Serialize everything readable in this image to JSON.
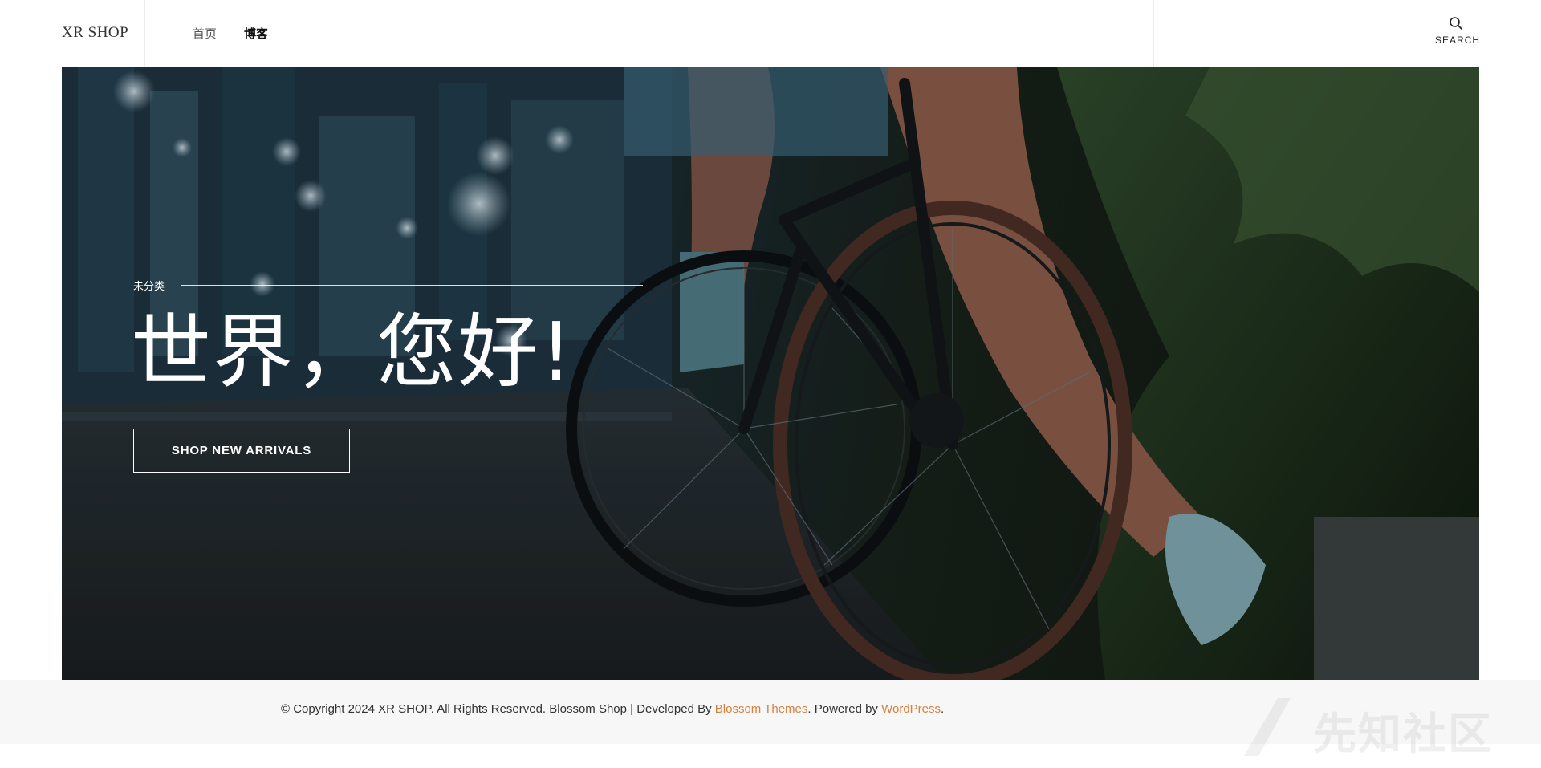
{
  "header": {
    "logo": "XR SHOP",
    "nav": [
      {
        "label": "首页",
        "active": false
      },
      {
        "label": "博客",
        "active": true
      }
    ],
    "search_label": "SEARCH"
  },
  "hero": {
    "category": "未分类",
    "title": "世界，您好!",
    "cta_label": "SHOP NEW ARRIVALS"
  },
  "footer": {
    "copyright": "© Copyright 2024 XR SHOP. All Rights Reserved. Blossom Shop | Developed By ",
    "developer_link": "Blossom Themes",
    "powered_prefix": ". Powered by ",
    "powered_link": "WordPress",
    "suffix": "."
  },
  "watermark": "先知社区",
  "colors": {
    "accent_link": "#d6813f",
    "footer_bg": "#f7f7f7"
  },
  "icons": {
    "search": "search-icon"
  }
}
